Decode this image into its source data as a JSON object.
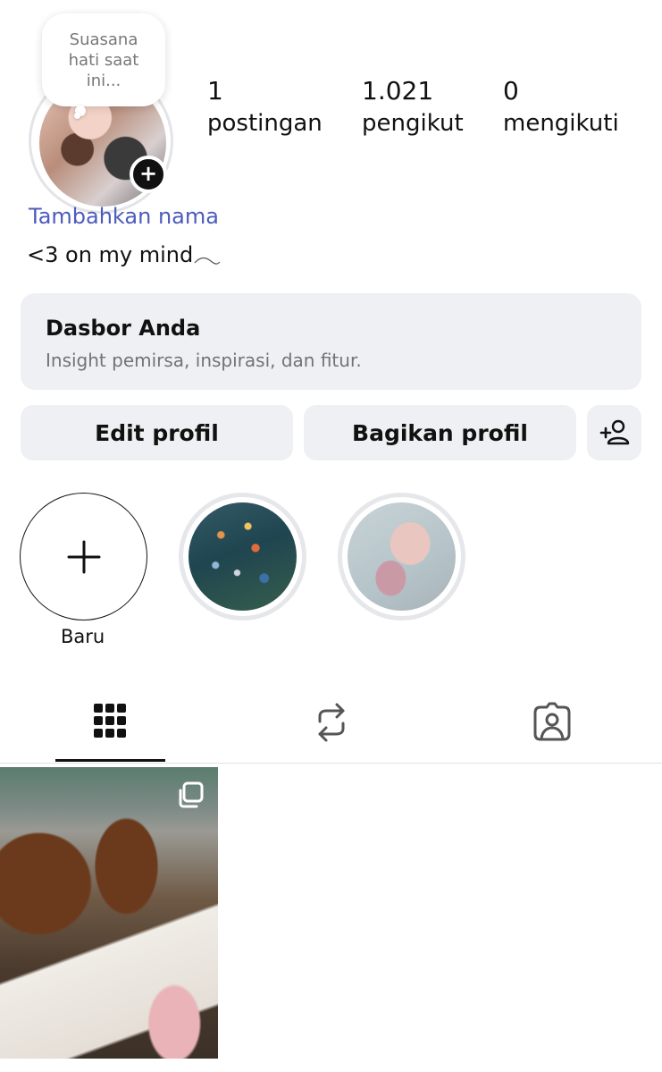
{
  "profile": {
    "note": "Suasana hati saat ini...",
    "add_name": "Tambahkan nama",
    "bio": "<3 on my mind"
  },
  "stats": {
    "posts": {
      "value": "1",
      "label": "postingan"
    },
    "followers": {
      "value": "1.021",
      "label": "pengikut"
    },
    "following": {
      "value": "0",
      "label": "mengikuti"
    }
  },
  "dashboard": {
    "title": "Dasbor Anda",
    "subtitle": "Insight pemirsa, inspirasi, dan fitur."
  },
  "actions": {
    "edit": "Edit profil",
    "share": "Bagikan profil",
    "discover_icon": "add-person-icon"
  },
  "highlights": {
    "new_label": "Baru",
    "items": [
      "fish-highlight",
      "shell-highlight"
    ]
  },
  "tabs": [
    {
      "icon": "grid-icon",
      "selected": true
    },
    {
      "icon": "repost-icon",
      "selected": false
    },
    {
      "icon": "tagged-icon",
      "selected": false
    }
  ],
  "posts": [
    {
      "type": "carousel",
      "icon": "multiple-photos-icon"
    }
  ],
  "colors": {
    "accent_link": "#4d5bbd",
    "button_bg": "#eff0f3",
    "text": "#111111",
    "muted": "#737373"
  }
}
